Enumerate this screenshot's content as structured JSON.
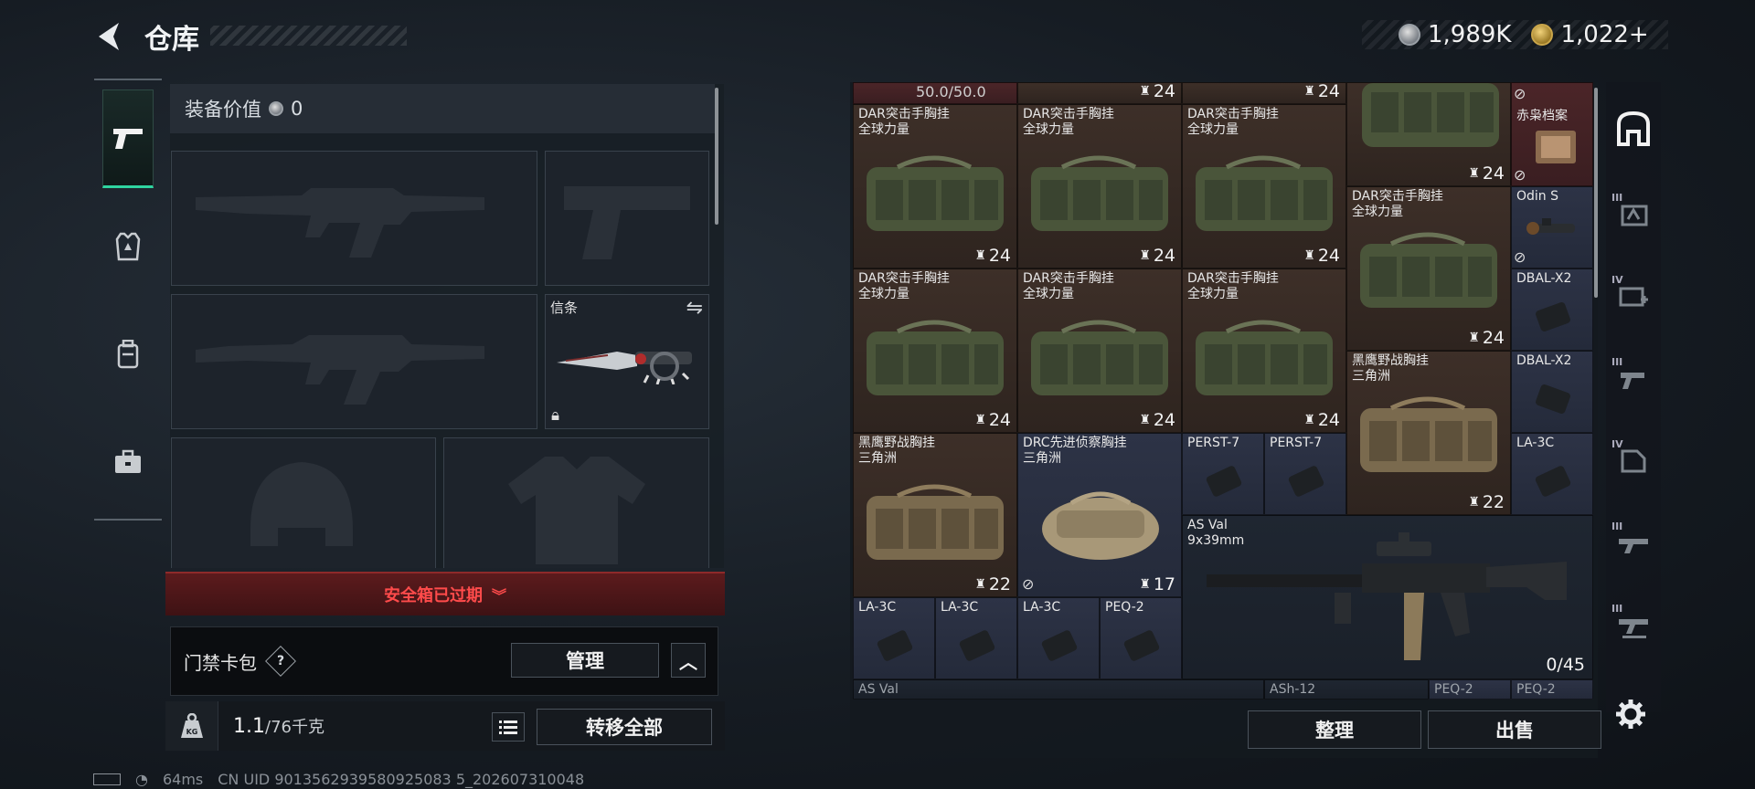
{
  "header": {
    "title": "仓库",
    "currency": [
      {
        "icon": "silver-coin-icon",
        "value": "1,989K"
      },
      {
        "icon": "gold-coin-icon",
        "value": "1,022+"
      }
    ]
  },
  "tabs": [
    {
      "icon": "pistol-icon",
      "active": true
    },
    {
      "icon": "armor-vest-icon",
      "active": false
    },
    {
      "icon": "backpack-icon",
      "active": false
    },
    {
      "icon": "briefcase-icon",
      "active": false
    }
  ],
  "loadout": {
    "value_label": "装备价值",
    "value": "0",
    "melee_slot_label": "信条",
    "safebox_status": "安全箱已过期",
    "keycard_label": "门禁卡包",
    "keycard_help": "?",
    "manage_label": "管理",
    "weight_value": "1.1",
    "weight_max": "/76千克",
    "kg_icon_label": "KG",
    "transfer_all_label": "转移全部"
  },
  "status": {
    "ping": "64ms",
    "uid": "CN UID 9013562939580925083 5_202607310048"
  },
  "warehouse": {
    "top_row": [
      "50.0/50.0",
      "24",
      "24"
    ],
    "items": [
      {
        "name": "DAR突击手胸挂\n全球力量",
        "count": "24"
      },
      {
        "name": "DAR突击手胸挂\n全球力量",
        "count": "24"
      },
      {
        "name": "DAR突击手胸挂\n全球力量",
        "count": "24"
      },
      {
        "name": "",
        "count": "24"
      },
      {
        "name": "赤枭档案",
        "count": ""
      },
      {
        "name": "DAR突击手胸挂\n全球力量",
        "count": "24"
      },
      {
        "name": "Odin S",
        "count": ""
      },
      {
        "name": "DAR突击手胸挂\n全球力量",
        "count": "24"
      },
      {
        "name": "DAR突击手胸挂\n全球力量",
        "count": "24"
      },
      {
        "name": "DAR突击手胸挂\n全球力量",
        "count": "24"
      },
      {
        "name": "DBAL-X2",
        "count": ""
      },
      {
        "name": "黑鹰野战胸挂\n三角洲",
        "count": "22"
      },
      {
        "name": "DBAL-X2",
        "count": ""
      },
      {
        "name": "黑鹰野战胸挂\n三角洲",
        "count": "22"
      },
      {
        "name": "DRC先进侦察胸挂\n三角洲",
        "count": "17"
      },
      {
        "name": "PERST-7",
        "count": ""
      },
      {
        "name": "PERST-7",
        "count": ""
      },
      {
        "name": "LA-3C",
        "count": ""
      },
      {
        "name": "AS Val\n9x39mm",
        "count": "0/45"
      },
      {
        "name": "LA-3C",
        "count": ""
      },
      {
        "name": "LA-3C",
        "count": ""
      },
      {
        "name": "LA-3C",
        "count": ""
      },
      {
        "name": "PEQ-2",
        "count": ""
      }
    ],
    "bottom_row": [
      "AS Val",
      "ASh-12",
      "PEQ-2",
      "PEQ-2"
    ],
    "sort_label": "整理",
    "sell_label": "出售"
  },
  "right_rail": [
    {
      "icon": "home-storage-icon",
      "level": ""
    },
    {
      "icon": "workshop-icon",
      "level": "III"
    },
    {
      "icon": "medical-icon",
      "level": "IV"
    },
    {
      "icon": "weapon-bench-icon",
      "level": "III"
    },
    {
      "icon": "archive-icon",
      "level": "IV"
    },
    {
      "icon": "rifle-rack-icon",
      "level": "III"
    },
    {
      "icon": "gun-rack-icon",
      "level": "III"
    }
  ]
}
